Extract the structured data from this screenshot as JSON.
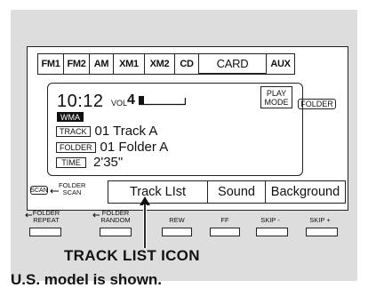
{
  "source_tabs": [
    "FM1",
    "FM2",
    "AM",
    "XM1",
    "XM2",
    "CD",
    "CARD",
    "AUX"
  ],
  "active_tab": "CARD",
  "display": {
    "clock": "10:12",
    "volume_label": "VOL",
    "volume_value": "4",
    "format_badge": "WMA",
    "play_mode_line1": "PLAY",
    "play_mode_line2": "MODE",
    "folder_badge": "FOLDER",
    "track_tag": "TRACK",
    "track_value": "01  Track A",
    "folder_tag": "FOLDER",
    "folder_value": "01  Folder A",
    "time_tag": "TIME",
    "time_value": "2'35\""
  },
  "softkeys": {
    "scan_button": "SCAN",
    "folder_scan_line1": "FOLDER",
    "folder_scan_line2": "SCAN",
    "track_list": "Track LIst",
    "sound": "Sound",
    "background": "Background"
  },
  "hardware_labels": {
    "folder_repeat_line1": "FOLDER",
    "folder_repeat_line2": "REPEAT",
    "folder_random_line1": "FOLDER",
    "folder_random_line2": "RANDOM",
    "rew": "REW",
    "ff": "FF",
    "skip_minus": "SKIP -",
    "skip_plus": "SKIP +"
  },
  "callout": "TRACK LIST ICON",
  "caption": "U.S. model is shown.",
  "colors": {
    "panel": "#dddddd",
    "ink": "#111111",
    "screen": "#ffffff"
  }
}
